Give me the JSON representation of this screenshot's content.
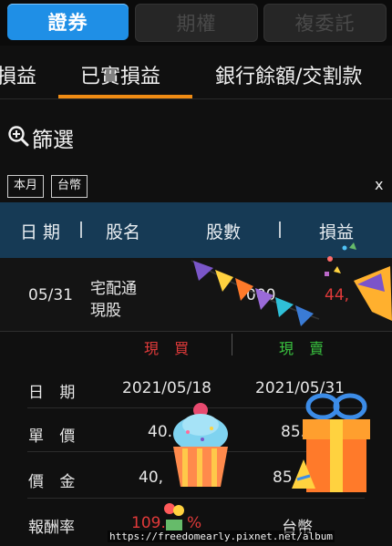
{
  "segments": [
    {
      "label": "證券",
      "active": true
    },
    {
      "label": "期權",
      "active": false
    },
    {
      "label": "複委託",
      "active": false
    }
  ],
  "tabs": [
    {
      "label": "損益"
    },
    {
      "label": "已實損益",
      "active": true
    },
    {
      "label": "銀行餘額/交割款"
    }
  ],
  "filter": {
    "label": "篩選",
    "icon": "zoom-search-icon"
  },
  "chips": [
    "本月",
    "台幣"
  ],
  "close_label": "x",
  "table": {
    "headers": [
      "日 期",
      "股名",
      "股數",
      "損益"
    ],
    "rows": [
      {
        "date": "05/31",
        "name_line1": "宅配通",
        "name_line2": "現股",
        "shares": "000",
        "pnl": "44,"
      }
    ]
  },
  "detail": {
    "buy_label": "現 買",
    "sell_label": "現 賣",
    "rows": [
      {
        "label": "日 期",
        "buy": "2021/05/18",
        "sell": "2021/05/31"
      },
      {
        "label": "單 價",
        "buy": "40.",
        "sell": "85."
      },
      {
        "label": "價 金",
        "buy": "40,",
        "sell": "85"
      },
      {
        "label": "報酬率",
        "buy": "109.",
        "buy_tail": "%",
        "sell": "台幣"
      }
    ]
  },
  "colors": {
    "accent_blue": "#1f8fe6",
    "orange": "#f08c14",
    "loss_red": "#e03a3a",
    "gain_green": "#39c23f",
    "header_bg": "#163a55"
  },
  "watermark": "https://freedomearly.pixnet.net/album"
}
